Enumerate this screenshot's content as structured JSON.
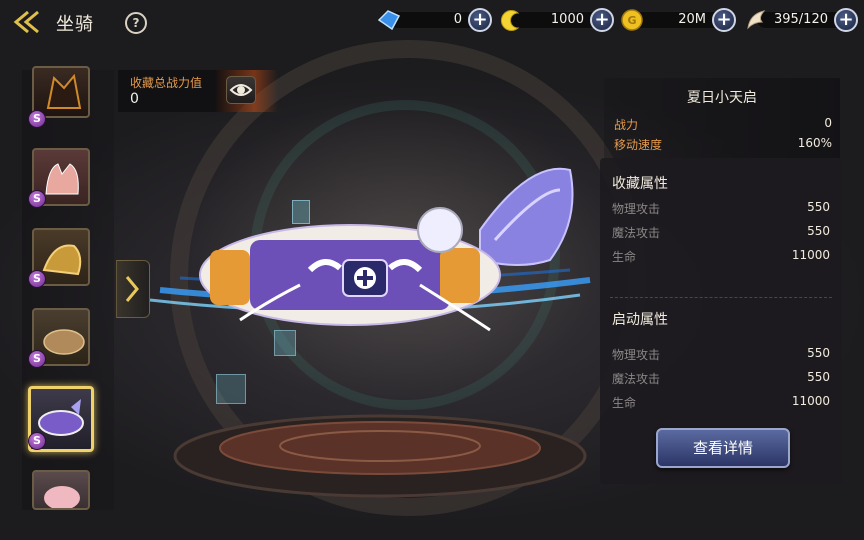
{
  "header": {
    "title": "坐骑",
    "help_icon": "?",
    "resources": [
      {
        "icon": "diamond-icon",
        "value": "0"
      },
      {
        "icon": "crescent-icon",
        "value": "1000"
      },
      {
        "icon": "gold-coin-icon",
        "value": "20M"
      },
      {
        "icon": "wing-stamina-icon",
        "value": "395/120"
      }
    ]
  },
  "collection_power": {
    "label": "收藏总战力值",
    "value": "0"
  },
  "mount_list": [
    {
      "name": "dark-warhorse",
      "rank": "S"
    },
    {
      "name": "fox",
      "rank": "S"
    },
    {
      "name": "golden-mount",
      "rank": "S"
    },
    {
      "name": "leopard",
      "rank": "S"
    },
    {
      "name": "summer-float-ring",
      "rank": "S",
      "selected": true
    },
    {
      "name": "pink-cloud",
      "rank": ""
    }
  ],
  "selected_mount": {
    "name": "夏日小天启",
    "stats": [
      {
        "label": "战力",
        "value": "0"
      },
      {
        "label": "移动速度",
        "value": "160%"
      }
    ]
  },
  "collection_attributes": {
    "title": "收藏属性",
    "items": [
      {
        "label": "物理攻击",
        "value": "550"
      },
      {
        "label": "魔法攻击",
        "value": "550"
      },
      {
        "label": "生命",
        "value": "11000"
      }
    ]
  },
  "active_attributes": {
    "title": "启动属性",
    "items": [
      {
        "label": "物理攻击",
        "value": "550"
      },
      {
        "label": "魔法攻击",
        "value": "550"
      },
      {
        "label": "生命",
        "value": "11000"
      }
    ]
  },
  "detail_button": {
    "label": "查看详情"
  },
  "colors": {
    "accent_orange": "#e59a4c",
    "select_gold": "#f0d26a",
    "button_blue": "#4a5a94"
  }
}
